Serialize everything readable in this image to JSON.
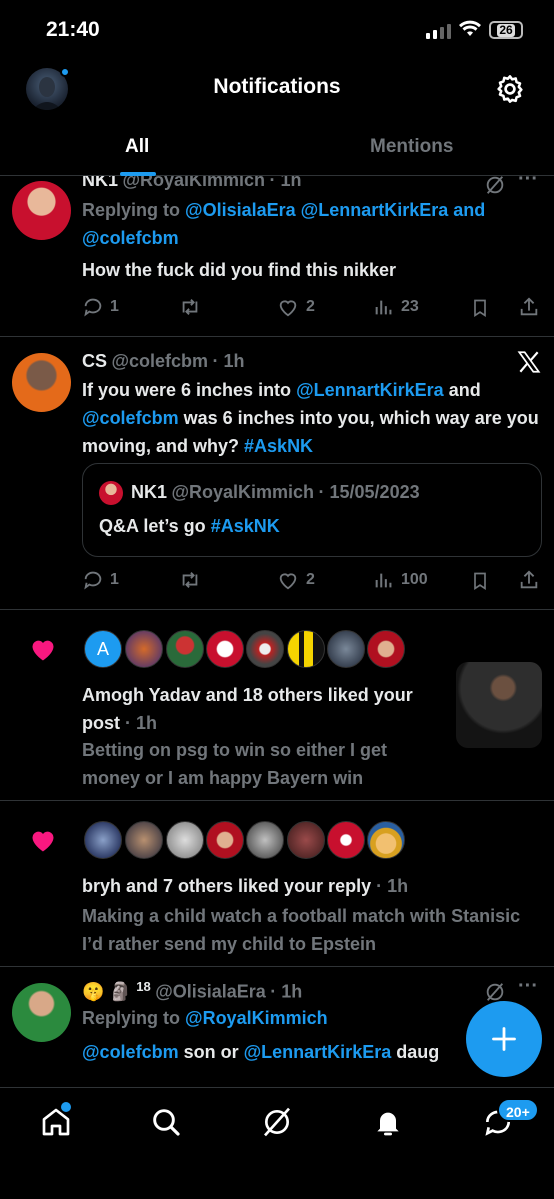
{
  "status_bar": {
    "time": "21:40",
    "battery": "26"
  },
  "header": {
    "title": "Notifications"
  },
  "tabs": [
    {
      "label": "All"
    },
    {
      "label": "Mentions"
    }
  ],
  "tweet1": {
    "name": "NK1",
    "handle": "@RoyalKimmich",
    "time": "· 1h",
    "replying_prefix": "Replying to",
    "reply_to_1": "@OlisialaEra",
    "reply_to_2": "@LennartKirkEra",
    "and": "and",
    "reply_to_3": "@colefcbm",
    "text": "How the fuck did you find this nikker",
    "replies": "1",
    "likes": "2",
    "views": "23"
  },
  "tweet2": {
    "name": "CS",
    "handle": "@colefcbm",
    "time": "· 1h",
    "text_a": "If you were 6 inches into",
    "mention_a": "@LennartKirkEra",
    "text_b": "and",
    "mention_b": "@colefcbm",
    "text_c": "was 6 inches into you, which way",
    "text_d": "are you moving, and why?",
    "hashtag": "#AskNK",
    "quote": {
      "name": "NK1",
      "handle": "@RoyalKimmich",
      "date": "· 15/05/2023",
      "text": "Q&A let’s go",
      "hashtag": "#AskNK"
    },
    "replies": "1",
    "likes": "2",
    "views": "100"
  },
  "like_notif_1": {
    "first_avatar_letter": "A",
    "line1": "Amogh Yadav and 18 others liked",
    "line2": "your post",
    "time": "· 1h",
    "preview1": "Betting on psg to win so either I get",
    "preview2": "money or I am happy Bayern win"
  },
  "like_notif_2": {
    "line1": "bryh and 7 others liked your reply",
    "time": "· 1h",
    "preview1": "Making a child watch a football match with",
    "preview2": "Stanisic I’d rather send my child to Epstein"
  },
  "tweet3": {
    "emojis": "🤫 🗿",
    "superscript": "18",
    "handle": "@OlisialaEra",
    "time": "· 1h",
    "replying_prefix": "Replying to",
    "reply_to": "@RoyalKimmich",
    "mention_a": "@colefcbm",
    "text_a": "son or",
    "mention_b": "@LennartKirkEra",
    "text_b": "daug"
  },
  "bottom_nav": {
    "messages_badge": "20+"
  },
  "colors": {
    "accent": "#1d9bf0",
    "like": "#f91880",
    "background": "#000000",
    "muted": "#71767b"
  }
}
